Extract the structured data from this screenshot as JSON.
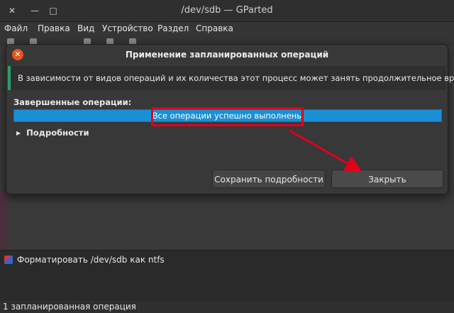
{
  "window": {
    "title": "/dev/sdb — GParted",
    "close_glyph": "✕",
    "minimize_glyph": "—",
    "maximize_glyph": "□"
  },
  "menu": {
    "items": [
      "Файл",
      "Правка",
      "Вид",
      "Устройство",
      "Раздел",
      "Справка"
    ]
  },
  "dialog": {
    "title": "Применение запланированных операций",
    "close_glyph": "✕",
    "info_text": "В зависимости от видов операций и их количества этот процесс может занять продолжительное время.",
    "completed_label": "Завершенные операции:",
    "progress_text": "Все операции успешно выполнены",
    "progress_fraction": 1.0,
    "details_label": "Подробности",
    "details_arrow": "▶",
    "save_details_button": "Сохранить подробности",
    "close_button": "Закрыть"
  },
  "operations": {
    "items": [
      "Форматировать /dev/sdb как ntfs"
    ]
  },
  "statusbar": {
    "text": "1 запланированная операция"
  },
  "colors": {
    "accent_red": "#e0001a",
    "progress_blue": "#1b8fd6",
    "info_green": "#26a269",
    "close_orange": "#e95420"
  }
}
